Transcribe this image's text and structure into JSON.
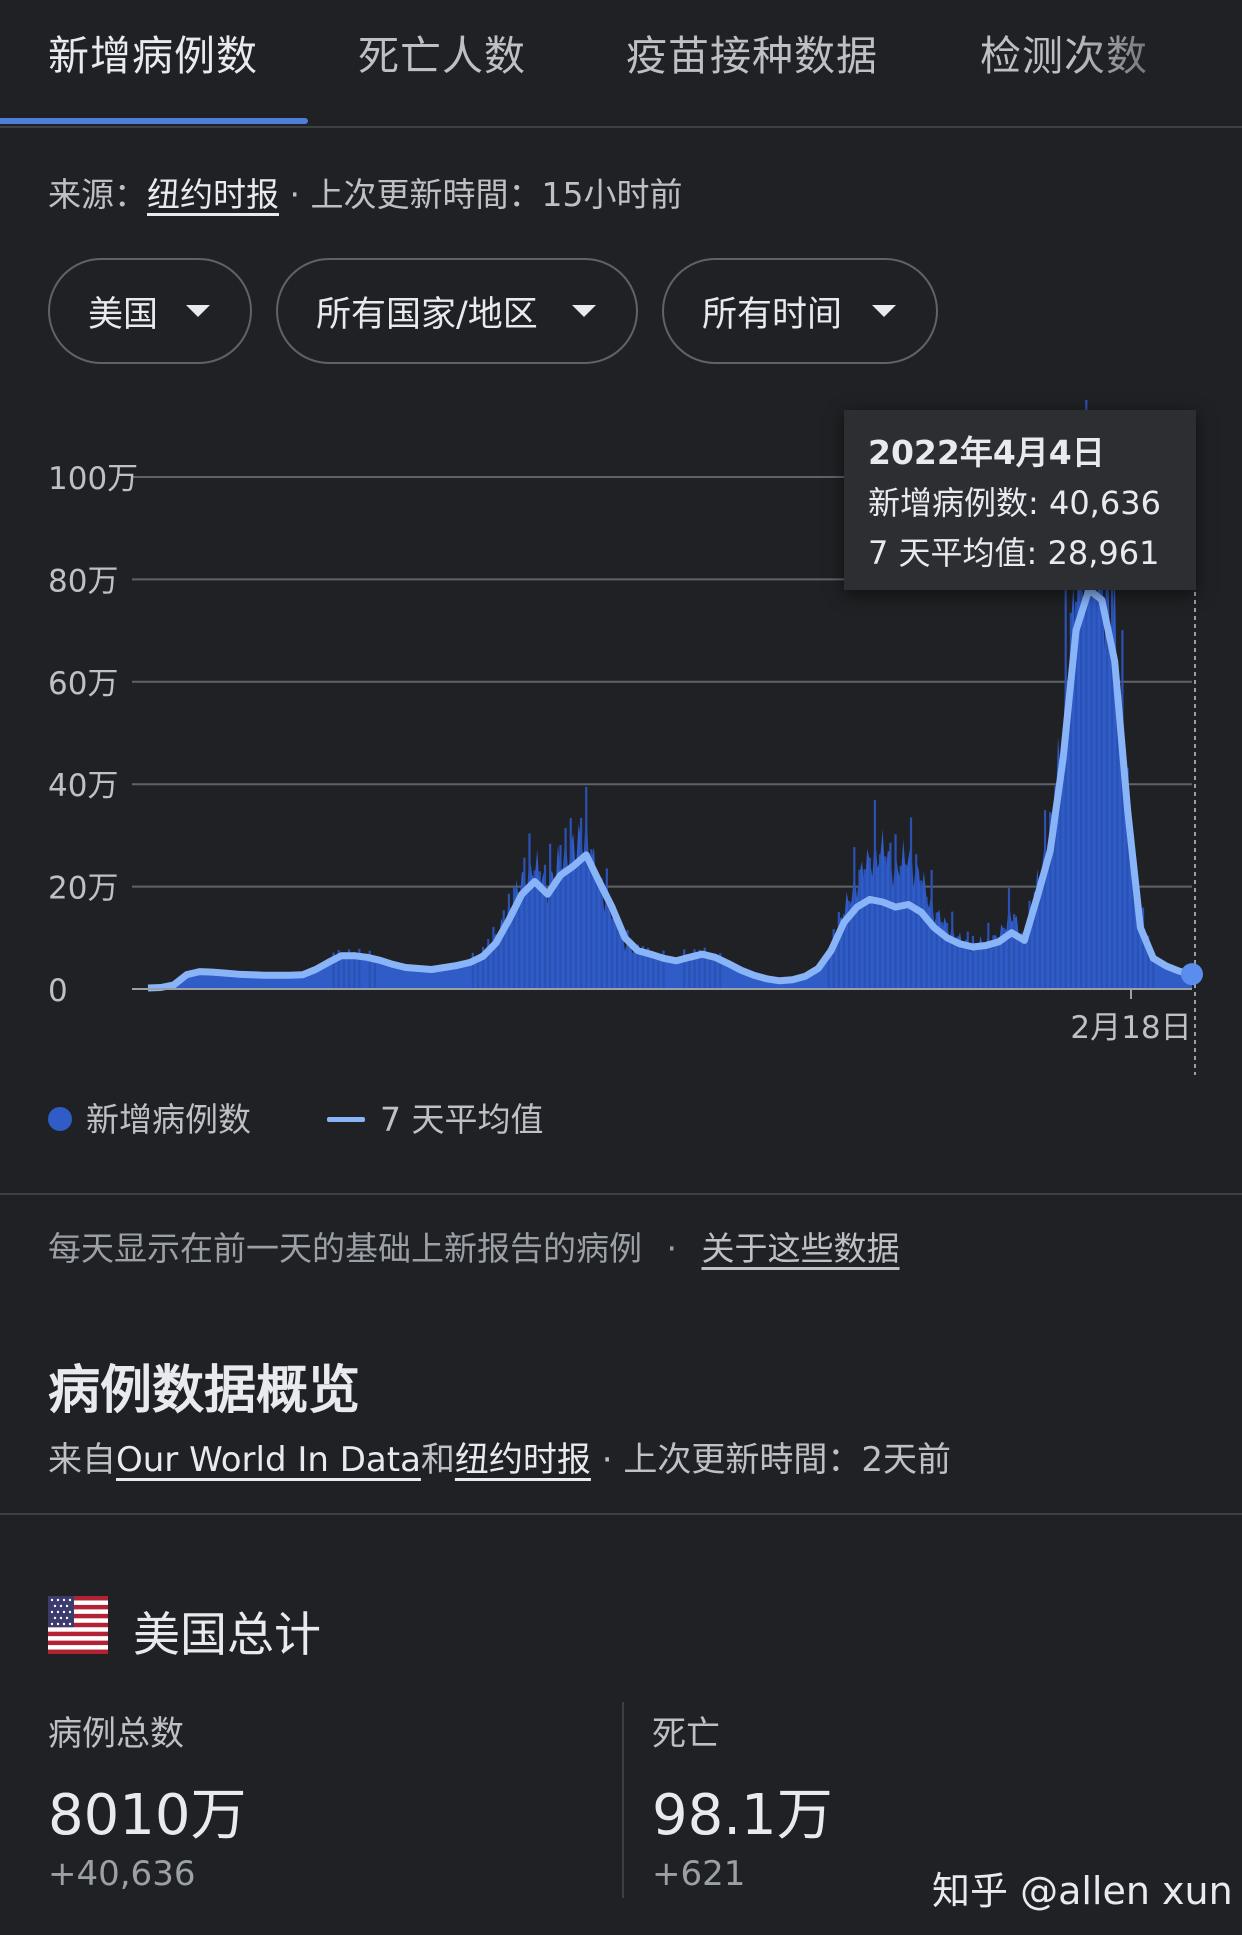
{
  "tabs": [
    {
      "label": "新增病例数",
      "active": true
    },
    {
      "label": "死亡人数"
    },
    {
      "label": "疫苗接种数据"
    },
    {
      "label": "检测次数"
    }
  ],
  "source": {
    "prefix": "来源：",
    "link": "纽约时报",
    "suffix": "· 上次更新時間：15小时前"
  },
  "filters": [
    {
      "label": "美国"
    },
    {
      "label": "所有国家/地区"
    },
    {
      "label": "所有时间"
    }
  ],
  "tooltip": {
    "date": "2022年4月4日",
    "cases_line": "新增病例数: 40,636",
    "avg_line": "7 天平均值: 28,961"
  },
  "legend": {
    "cases": "新增病例数",
    "average": "7 天平均值"
  },
  "chart_data": {
    "type": "area",
    "yticks": [
      "100万",
      "80万",
      "60万",
      "40万",
      "20万",
      "0"
    ],
    "ylim": [
      0,
      1000000
    ],
    "xticks": [
      "2月18日"
    ],
    "grid": true,
    "series": [
      {
        "name": "新增病例数",
        "color": "#2f5cc7",
        "values": [
          2000,
          3500,
          9000,
          30000,
          36000,
          33000,
          31000,
          29000,
          28000,
          27000,
          27000,
          27000,
          28000,
          40000,
          55000,
          68000,
          66000,
          62000,
          56000,
          48000,
          42000,
          40000,
          38000,
          43000,
          48000,
          55000,
          70000,
          100000,
          150000,
          210000,
          240000,
          200000,
          250000,
          275000,
          300000,
          200000,
          150000,
          90000,
          75000,
          70000,
          60000,
          55000,
          65000,
          70000,
          62000,
          50000,
          35000,
          25000,
          18000,
          15000,
          18000,
          25000,
          40000,
          80000,
          150000,
          210000,
          250000,
          270000,
          230000,
          260000,
          210000,
          150000,
          120000,
          95000,
          85000,
          90000,
          100000,
          150000,
          90000,
          200000,
          300000,
          500000,
          780000,
          900000,
          820000,
          700000,
          380000,
          130000,
          65000,
          50000,
          40000,
          40636
        ]
      },
      {
        "name": "7 天平均值",
        "color": "#8ab4f8",
        "values": [
          2000,
          3000,
          8000,
          28000,
          34000,
          33000,
          31000,
          29000,
          28000,
          27000,
          27000,
          27000,
          28000,
          38000,
          52000,
          65000,
          65000,
          62000,
          56000,
          48000,
          42000,
          40000,
          38000,
          42000,
          46000,
          52000,
          64000,
          90000,
          135000,
          185000,
          210000,
          185000,
          222000,
          240000,
          262000,
          210000,
          160000,
          100000,
          75000,
          68000,
          60000,
          55000,
          62000,
          68000,
          62000,
          50000,
          37000,
          27000,
          20000,
          16000,
          18000,
          25000,
          40000,
          75000,
          130000,
          160000,
          175000,
          170000,
          160000,
          165000,
          150000,
          120000,
          100000,
          88000,
          82000,
          85000,
          92000,
          110000,
          95000,
          180000,
          270000,
          450000,
          700000,
          780000,
          760000,
          640000,
          350000,
          120000,
          60000,
          45000,
          35000,
          28961
        ]
      }
    ]
  },
  "note": {
    "text": "每天显示在前一天的基础上新报告的病例",
    "sep": "·",
    "link": "关于这些数据"
  },
  "overview": {
    "title": "病例数据概览",
    "from_prefix": "来自",
    "link1": "Our World In Data",
    "and": "和",
    "link2": "纽约时报",
    "suffix": "· 上次更新時間：2天前"
  },
  "totals": {
    "title": "美国总计",
    "cases_label": "病例总数",
    "cases_value": "8010万",
    "cases_delta": "+40,636",
    "deaths_label": "死亡",
    "deaths_value": "98.1万",
    "deaths_delta": "+621"
  },
  "watermark": "知乎 @allen xun"
}
